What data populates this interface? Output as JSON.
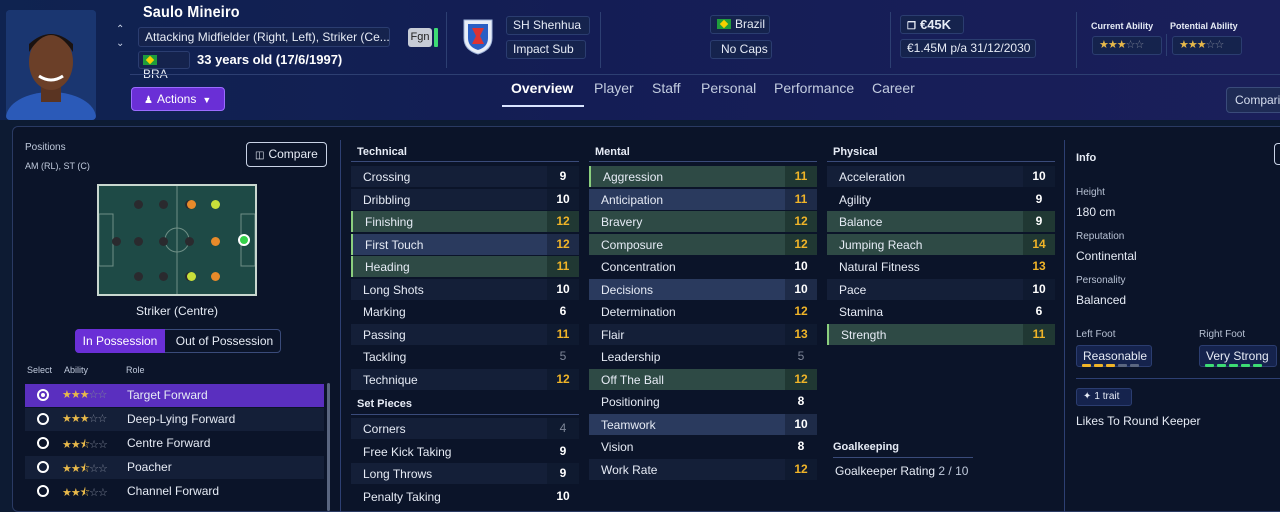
{
  "player": {
    "name": "Saulo Mineiro",
    "positions_long": "Attacking Midfielder (Right, Left), Striker (Ce...",
    "nationality_code": "BRA",
    "age_text": "33 years old (17/6/1997)",
    "fgn_badge": "Fgn",
    "actions_label": "Actions"
  },
  "club": {
    "name": "SH Shenhua",
    "status": "Impact Sub"
  },
  "country": {
    "name": "Brazil",
    "caps": "No Caps"
  },
  "value": {
    "amount": "€45K",
    "wage": "€1.45M p/a",
    "contract_end": "31/12/2030"
  },
  "ability": {
    "current_label": "Current Ability",
    "potential_label": "Potential Ability",
    "current_stars": 3,
    "potential_stars": 3
  },
  "tabs": [
    "Overview",
    "Player",
    "Staff",
    "Personal",
    "Performance",
    "Career"
  ],
  "comparison_label": "Comparis",
  "positions_panel": {
    "title": "Positions",
    "summary": "AM (RL), ST (C)",
    "compare_label": "Compare",
    "selected_position": "Striker (Centre)",
    "in_possession": "In Possession",
    "out_of_possession": "Out of Possession",
    "hdr_select": "Select",
    "hdr_ability": "Ability",
    "hdr_role": "Role",
    "roles": [
      {
        "name": "Target Forward",
        "stars": 3,
        "selected": true
      },
      {
        "name": "Deep-Lying Forward",
        "stars": 3,
        "selected": false
      },
      {
        "name": "Centre Forward",
        "stars": 2.5,
        "selected": false
      },
      {
        "name": "Poacher",
        "stars": 2.5,
        "selected": false
      },
      {
        "name": "Channel Forward",
        "stars": 2.5,
        "selected": false
      }
    ]
  },
  "technical": {
    "title": "Technical",
    "attrs": [
      {
        "name": "Crossing",
        "value": "9"
      },
      {
        "name": "Dribbling",
        "value": "10"
      },
      {
        "name": "Finishing",
        "value": "12"
      },
      {
        "name": "First Touch",
        "value": "12"
      },
      {
        "name": "Heading",
        "value": "11"
      },
      {
        "name": "Long Shots",
        "value": "10"
      },
      {
        "name": "Marking",
        "value": "6"
      },
      {
        "name": "Passing",
        "value": "11"
      },
      {
        "name": "Tackling",
        "value": "5"
      },
      {
        "name": "Technique",
        "value": "12"
      }
    ]
  },
  "set_pieces": {
    "title": "Set Pieces",
    "attrs": [
      {
        "name": "Corners",
        "value": "4"
      },
      {
        "name": "Free Kick Taking",
        "value": "9"
      },
      {
        "name": "Long Throws",
        "value": "9"
      },
      {
        "name": "Penalty Taking",
        "value": "10"
      }
    ]
  },
  "mental": {
    "title": "Mental",
    "attrs": [
      {
        "name": "Aggression",
        "value": "11"
      },
      {
        "name": "Anticipation",
        "value": "11"
      },
      {
        "name": "Bravery",
        "value": "12"
      },
      {
        "name": "Composure",
        "value": "12"
      },
      {
        "name": "Concentration",
        "value": "10"
      },
      {
        "name": "Decisions",
        "value": "10"
      },
      {
        "name": "Determination",
        "value": "12"
      },
      {
        "name": "Flair",
        "value": "13"
      },
      {
        "name": "Leadership",
        "value": "5"
      },
      {
        "name": "Off The Ball",
        "value": "12"
      },
      {
        "name": "Positioning",
        "value": "8"
      },
      {
        "name": "Teamwork",
        "value": "10"
      },
      {
        "name": "Vision",
        "value": "8"
      },
      {
        "name": "Work Rate",
        "value": "12"
      }
    ]
  },
  "physical": {
    "title": "Physical",
    "attrs": [
      {
        "name": "Acceleration",
        "value": "10"
      },
      {
        "name": "Agility",
        "value": "9"
      },
      {
        "name": "Balance",
        "value": "9"
      },
      {
        "name": "Jumping Reach",
        "value": "14"
      },
      {
        "name": "Natural Fitness",
        "value": "13"
      },
      {
        "name": "Pace",
        "value": "10"
      },
      {
        "name": "Stamina",
        "value": "6"
      },
      {
        "name": "Strength",
        "value": "11"
      }
    ]
  },
  "goalkeeping": {
    "title": "Goalkeeping",
    "rating_label": "Goalkeeper Rating",
    "rating_value": "2 / 10"
  },
  "info": {
    "title": "Info",
    "height_label": "Height",
    "height": "180 cm",
    "reputation_label": "Reputation",
    "reputation": "Continental",
    "personality_label": "Personality",
    "personality": "Balanced",
    "left_foot_label": "Left Foot",
    "left_foot": "Reasonable",
    "right_foot_label": "Right Foot",
    "right_foot": "Very Strong",
    "traits_count": "1 trait",
    "trait": "Likes To Round Keeper"
  }
}
